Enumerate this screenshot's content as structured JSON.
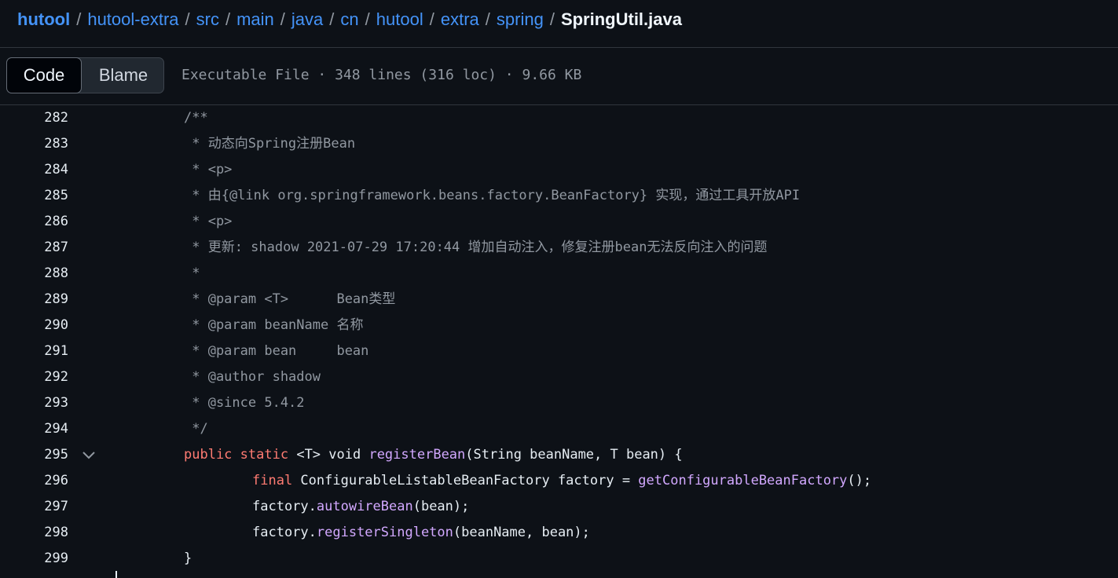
{
  "breadcrumb": {
    "parts": [
      "hutool",
      "hutool-extra",
      "src",
      "main",
      "java",
      "cn",
      "hutool",
      "extra",
      "spring"
    ],
    "current": "SpringUtil.java",
    "separator": "/"
  },
  "toolbar": {
    "code_label": "Code",
    "blame_label": "Blame",
    "file_info": "Executable File · 348 lines (316 loc) · 9.66 KB"
  },
  "colors": {
    "background": "#0d1117",
    "link": "#4493f8",
    "comment": "#9198a1",
    "keyword": "#ff7b72",
    "function": "#d2a8ff",
    "text": "#e6edf3"
  },
  "code": {
    "lines": [
      {
        "number": "282",
        "tokens": [
          {
            "t": "/**",
            "c": "comment"
          }
        ]
      },
      {
        "number": "283",
        "tokens": [
          {
            "t": " * 动态向Spring注册Bean",
            "c": "comment"
          }
        ]
      },
      {
        "number": "284",
        "tokens": [
          {
            "t": " * <p>",
            "c": "comment"
          }
        ]
      },
      {
        "number": "285",
        "tokens": [
          {
            "t": " * 由{@link org.springframework.beans.factory.BeanFactory} 实现，通过工具开放API",
            "c": "comment"
          }
        ]
      },
      {
        "number": "286",
        "tokens": [
          {
            "t": " * <p>",
            "c": "comment"
          }
        ]
      },
      {
        "number": "287",
        "tokens": [
          {
            "t": " * 更新: shadow 2021-07-29 17:20:44 增加自动注入，修复注册bean无法反向注入的问题",
            "c": "comment"
          }
        ]
      },
      {
        "number": "288",
        "tokens": [
          {
            "t": " *",
            "c": "comment"
          }
        ]
      },
      {
        "number": "289",
        "tokens": [
          {
            "t": " * @param <T>      Bean类型",
            "c": "comment"
          }
        ]
      },
      {
        "number": "290",
        "tokens": [
          {
            "t": " * @param beanName 名称",
            "c": "comment"
          }
        ]
      },
      {
        "number": "291",
        "tokens": [
          {
            "t": " * @param bean     bean",
            "c": "comment"
          }
        ]
      },
      {
        "number": "292",
        "tokens": [
          {
            "t": " * @author shadow",
            "c": "comment"
          }
        ]
      },
      {
        "number": "293",
        "tokens": [
          {
            "t": " * @since 5.4.2",
            "c": "comment"
          }
        ]
      },
      {
        "number": "294",
        "tokens": [
          {
            "t": " */",
            "c": "comment"
          }
        ]
      },
      {
        "number": "295",
        "fold": true,
        "tokens": [
          {
            "t": "public",
            "c": "kw"
          },
          {
            "t": " ",
            "c": "plain"
          },
          {
            "t": "static",
            "c": "kw"
          },
          {
            "t": " <T> void ",
            "c": "plain"
          },
          {
            "t": "registerBean",
            "c": "fn"
          },
          {
            "t": "(String beanName, T bean) {",
            "c": "plain"
          }
        ]
      },
      {
        "number": "296",
        "tokens": [
          {
            "t": "\t",
            "c": "plain"
          },
          {
            "t": "final",
            "c": "kw"
          },
          {
            "t": " ConfigurableListableBeanFactory factory = ",
            "c": "plain"
          },
          {
            "t": "getConfigurableBeanFactory",
            "c": "fn"
          },
          {
            "t": "();",
            "c": "plain"
          }
        ]
      },
      {
        "number": "297",
        "tokens": [
          {
            "t": "\tfactory.",
            "c": "plain"
          },
          {
            "t": "autowireBean",
            "c": "fn"
          },
          {
            "t": "(bean);",
            "c": "plain"
          }
        ]
      },
      {
        "number": "298",
        "tokens": [
          {
            "t": "\tfactory.",
            "c": "plain"
          },
          {
            "t": "registerSingleton",
            "c": "fn"
          },
          {
            "t": "(beanName, bean);",
            "c": "plain"
          }
        ]
      },
      {
        "number": "299",
        "tokens": [
          {
            "t": "}",
            "c": "plain"
          }
        ]
      }
    ]
  }
}
